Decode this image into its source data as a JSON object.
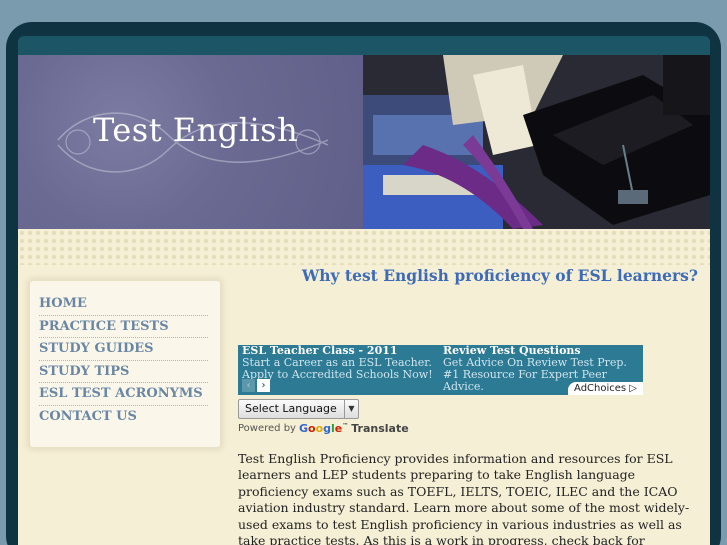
{
  "site": {
    "title": "Test English"
  },
  "page": {
    "heading": "Why test English proficiency of ESL learners?"
  },
  "nav": {
    "items": [
      {
        "label": "HOME"
      },
      {
        "label": "PRACTICE TESTS"
      },
      {
        "label": "STUDY GUIDES"
      },
      {
        "label": "STUDY TIPS"
      },
      {
        "label": "ESL TEST ACRONYMS"
      },
      {
        "label": "CONTACT US"
      }
    ]
  },
  "ads": {
    "items": [
      {
        "title": "ESL Teacher Class - 2011",
        "text": "Start a Career as an ESL Teacher. Apply to Accredited Schools Now!"
      },
      {
        "title": "Review Test Questions",
        "text": "Get Advice On Review Test Prep. #1 Resource For Expert Peer Advice."
      }
    ],
    "adchoices": "AdChoices ▷",
    "prev_icon": "‹",
    "next_icon": "›"
  },
  "translate": {
    "select_label": "Select Language",
    "caret": "▼",
    "powered_by": "Powered by",
    "google": "Google™",
    "translate_label": "Translate"
  },
  "content": {
    "intro": "Test English Proficiency provides information and resources for ESL learners and LEP students preparing to take English language proficiency exams such as TOEFL, IELTS, TOEIC, ILEC and the ICAO aviation industry standard.  Learn more about some of  the most widely-used exams to test English proficiency in various industries as well as take practice tests.  As this is a work in progress, check back for updates."
  },
  "colors": {
    "nav_link": "#6a86a3",
    "heading": "#3e6bb7",
    "ad_bg": "#2c7a94",
    "content_bg": "#f5efd5"
  }
}
